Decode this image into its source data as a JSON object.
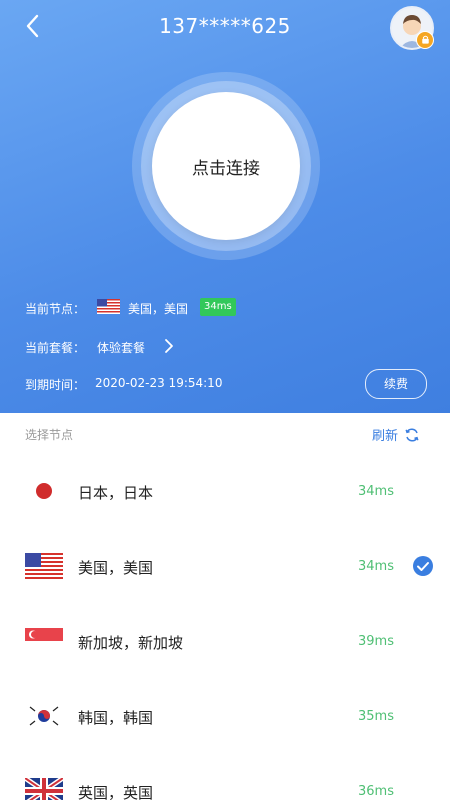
{
  "header": {
    "title": "137*****625",
    "connect_label": "点击连接",
    "current_node_label": "当前节点：",
    "current_node_value": "美国，美国",
    "current_latency": "34ms",
    "current_plan_label": "当前套餐：",
    "current_plan_value": "体验套餐",
    "expiry_label": "到期时间：",
    "expiry_value": "2020-02-23 19:54:10",
    "renew_label": "续费"
  },
  "list": {
    "section_label": "选择节点",
    "refresh_label": "刷新",
    "nodes": [
      {
        "flag": "japan-flag",
        "name": "日本，日本",
        "latency": "34ms",
        "selected": false
      },
      {
        "flag": "usa-flag",
        "name": "美国，美国",
        "latency": "34ms",
        "selected": true
      },
      {
        "flag": "singapore-flag",
        "name": "新加坡，新加坡",
        "latency": "39ms",
        "selected": false
      },
      {
        "flag": "korea-flag",
        "name": "韩国，韩国",
        "latency": "35ms",
        "selected": false
      },
      {
        "flag": "uk-flag",
        "name": "英国，英国",
        "latency": "36ms",
        "selected": false
      }
    ]
  },
  "colors": {
    "header_blue": "#4d8ce8",
    "accent_blue": "#3a7ee0",
    "latency_green": "#4fbf74",
    "badge_green": "#32c85a",
    "lock_orange": "#f5a623"
  }
}
